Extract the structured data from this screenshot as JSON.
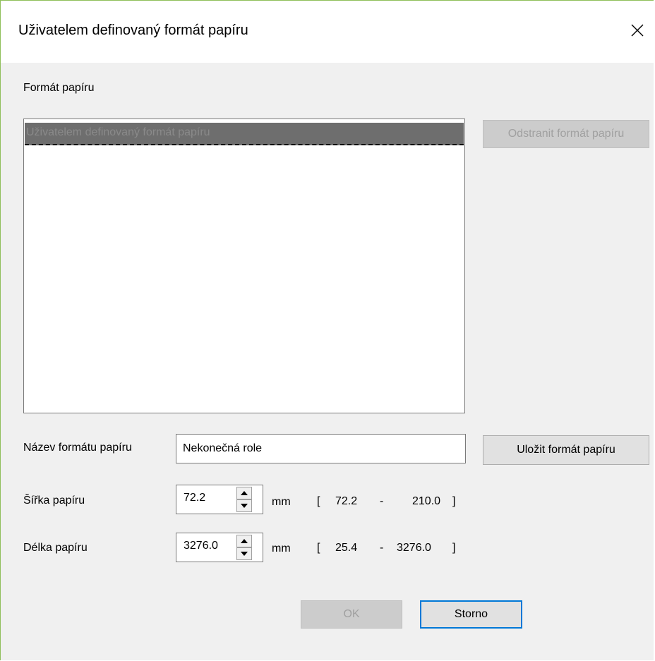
{
  "dialog": {
    "title": "Uživatelem definovaný formát papíru",
    "close_icon": "close-icon"
  },
  "paper_format_section": {
    "label": "Formát papíru",
    "list_items": [
      "Uživatelem definovaný formát papíru"
    ],
    "remove_button_label": "Odstranit formát papíru"
  },
  "name_field": {
    "label": "Název formátu papíru",
    "value": "Nekonečná role",
    "save_button_label": "Uložit formát papíru"
  },
  "width_field": {
    "label": "Šířka papíru",
    "value": "72.2",
    "unit": "mm",
    "range_open": "[",
    "range_min": "72.2",
    "range_dash": "-",
    "range_max": "210.0",
    "range_close": "]"
  },
  "length_field": {
    "label": "Délka papíru",
    "value": "3276.0",
    "unit": "mm",
    "range_open": "[",
    "range_min": "25.4",
    "range_dash": "-",
    "range_max": "3276.0",
    "range_close": "]"
  },
  "footer": {
    "ok_label": "OK",
    "cancel_label": "Storno"
  },
  "colors": {
    "window_border": "#8fbf5a",
    "dialog_bg": "#f0f0f0",
    "accent": "#0078d7",
    "selected_item_bg": "#6e6e6e"
  }
}
